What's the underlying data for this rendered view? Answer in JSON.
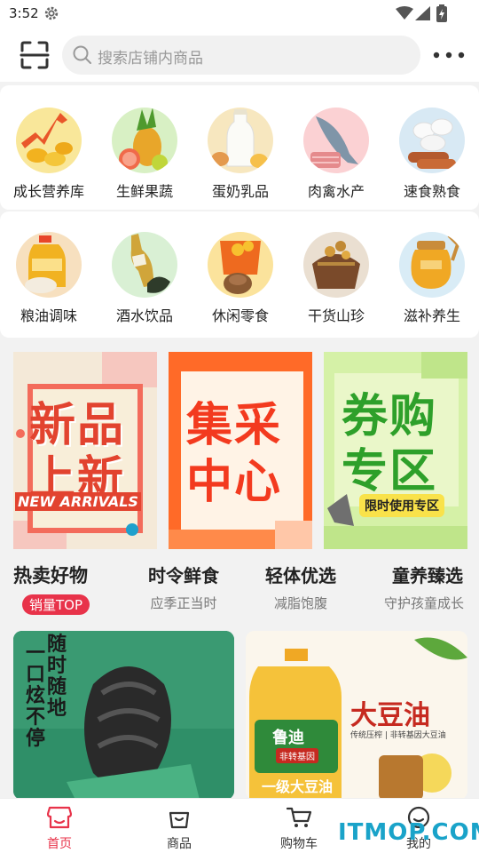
{
  "status_bar": {
    "time": "3:52"
  },
  "search": {
    "placeholder": "搜索店铺内商品"
  },
  "categories_row1": [
    {
      "label": "成长营养库"
    },
    {
      "label": "生鲜果蔬"
    },
    {
      "label": "蛋奶乳品"
    },
    {
      "label": "肉禽水产"
    },
    {
      "label": "速食熟食"
    }
  ],
  "categories_row2": [
    {
      "label": "粮油调味"
    },
    {
      "label": "酒水饮品"
    },
    {
      "label": "休闲零食"
    },
    {
      "label": "干货山珍"
    },
    {
      "label": "滋补养生"
    }
  ],
  "banners": [
    {
      "line1": "新品",
      "line2": "上新",
      "english": "NEW ARRIVALS"
    },
    {
      "line1": "集采",
      "line2": "中心"
    },
    {
      "line1": "券购",
      "line2": "专区",
      "tag": "限时使用专区"
    }
  ],
  "tabs": [
    {
      "title": "热卖好物",
      "badge": "销量TOP"
    },
    {
      "title": "时令鲜食",
      "subtitle": "应季正当时"
    },
    {
      "title": "轻体优选",
      "subtitle": "减脂饱腹"
    },
    {
      "title": "童养臻选",
      "subtitle": "守护孩童成长"
    }
  ],
  "products": [
    {
      "vertical_text_1": "一口炫不停",
      "vertical_text_2": "随时随地"
    },
    {
      "headline": "大豆油",
      "tagline": "传统压榨 | 非转基因大豆油",
      "brand": "鲁迪",
      "bottle_label": "一级大豆油",
      "badge": "非转基因"
    }
  ],
  "bottom_nav": [
    {
      "label": "首页"
    },
    {
      "label": "商品"
    },
    {
      "label": "购物车"
    },
    {
      "label": "我的"
    }
  ],
  "watermark": "ITMOP.COM",
  "colors": {
    "accent": "#e8334a",
    "watermark": "#1aa3c9"
  }
}
